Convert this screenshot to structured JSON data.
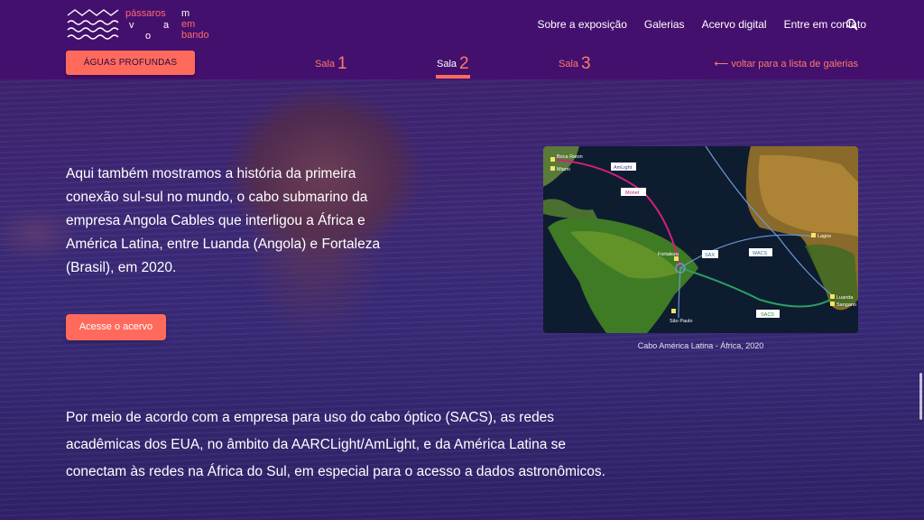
{
  "logo": {
    "words": [
      "pássaros",
      "v",
      "o",
      "a",
      "m",
      "em",
      "bando"
    ]
  },
  "nav": {
    "items": [
      "Sobre a exposição",
      "Galerias",
      "Acervo digital",
      "Entre em contato"
    ]
  },
  "section_button": "ÁGUAS PROFUNDAS",
  "salas": [
    {
      "label": "Sala",
      "num": "1"
    },
    {
      "label": "Sala",
      "num": "2"
    },
    {
      "label": "Sala",
      "num": "3"
    }
  ],
  "back_link": "⟵ voltar para a lista de galerias",
  "main": {
    "paragraph1": "Aqui também mostramos a história da primeira conexão sul-sul no mundo, o cabo submarino da empresa Angola Cables que interligou a África e América Latina, entre Luanda (Angola) e Fortaleza (Brasil), em 2020.",
    "acervo_button": "Acesse o acervo",
    "paragraph2": "Por meio de acordo com a empresa para uso do cabo óptico (SACS), as redes acadêmicas dos EUA, no âmbito da AARCLight/AmLight, e da América Latina se conectam às redes na África do Sul, em especial para o acesso a dados astronômicos."
  },
  "map": {
    "labels": {
      "boca_raton": "Boca Raton",
      "miami": "Miami",
      "amlight": "AmLight",
      "monet": "Monet",
      "fortaleza": "Fortaleza",
      "sax": "SAX",
      "wacs": "WACS",
      "lagos": "Lagos",
      "luanda": "Luanda",
      "sangano": "Sangano",
      "sacs": "SACS",
      "sao_paulo": "São Paulo"
    },
    "caption": "Cabo América Latina - África, 2020"
  },
  "colors": {
    "header_bg": "#44106e",
    "accent": "#ff6a5c"
  }
}
